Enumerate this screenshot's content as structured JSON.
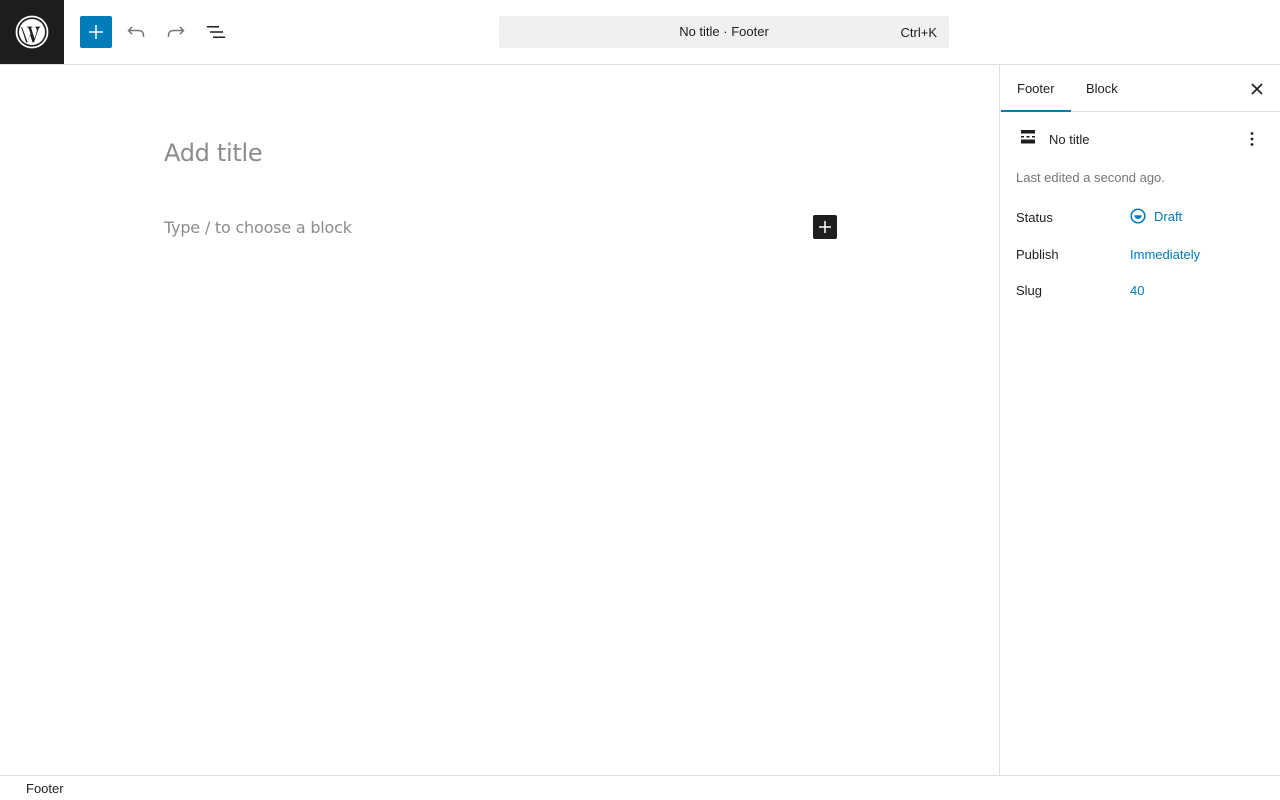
{
  "toolbar": {
    "logo_icon": "wordpress-logo-icon",
    "inserter_icon": "plus-icon",
    "undo_icon": "undo-icon",
    "redo_icon": "redo-icon",
    "list_view_icon": "list-view-icon",
    "command_title": "No title · Footer",
    "command_shortcut": "Ctrl+K"
  },
  "canvas": {
    "title_placeholder": "Add title",
    "block_placeholder": "Type / to choose a block",
    "block_inserter_icon": "plus-icon"
  },
  "sidebar": {
    "tabs": [
      {
        "label": "Footer",
        "active": true
      },
      {
        "label": "Block",
        "active": false
      }
    ],
    "close_icon": "close-icon",
    "document": {
      "icon": "template-part-footer-icon",
      "title": "No title",
      "more_icon": "more-vertical-icon"
    },
    "last_edited": "Last edited a second ago.",
    "rows": {
      "status": {
        "label": "Status",
        "value": "Draft",
        "icon": "draft-circle-icon"
      },
      "publish": {
        "label": "Publish",
        "value": "Immediately"
      },
      "slug": {
        "label": "Slug",
        "value": "40"
      }
    }
  },
  "footer": {
    "breadcrumb": "Footer"
  },
  "colors": {
    "accent": "#007cba",
    "dark": "#1e1e1e",
    "placeholder": "#8c8c8c",
    "muted": "#757575",
    "border": "#e0e0e0",
    "command_bg": "#f0f0f0"
  }
}
